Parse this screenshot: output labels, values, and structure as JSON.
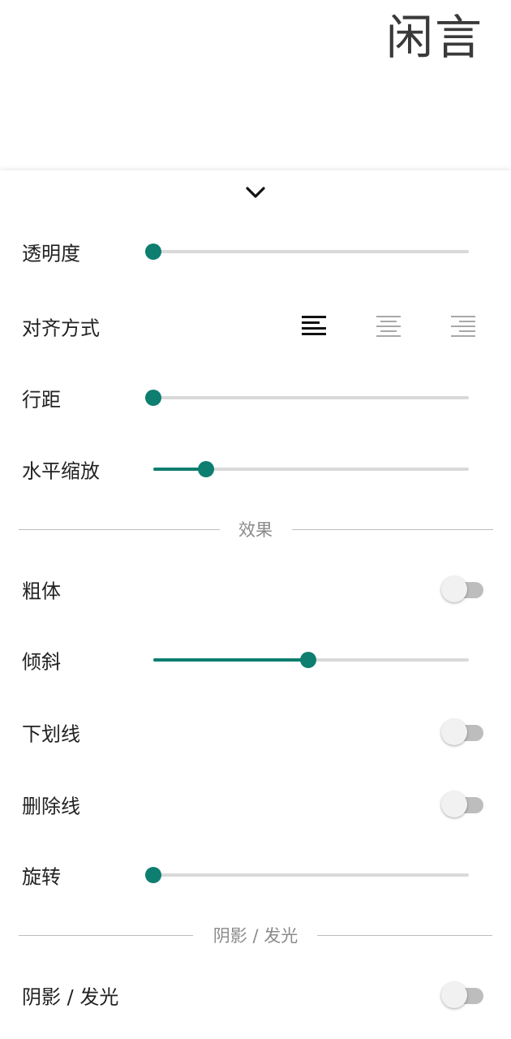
{
  "preview": {
    "text": "闲言"
  },
  "panel": {
    "collapse_icon": "chevron-down-icon",
    "accent_color": "#0d7e6f",
    "opacity": {
      "label": "透明度",
      "value": 0.0
    },
    "alignment": {
      "label": "对齐方式",
      "options": [
        "align-left-icon",
        "align-center-icon",
        "align-right-icon"
      ],
      "selected": "left"
    },
    "line_spacing": {
      "label": "行距",
      "value": 0.0
    },
    "horizontal_scale": {
      "label": "水平缩放",
      "value": 0.166
    },
    "effects_section": {
      "label": "效果"
    },
    "bold": {
      "label": "粗体",
      "on": false
    },
    "italic": {
      "label": "倾斜",
      "value": 0.49
    },
    "underline": {
      "label": "下划线",
      "on": false
    },
    "strikethrough": {
      "label": "删除线",
      "on": false
    },
    "rotation": {
      "label": "旋转",
      "value": 0.0
    },
    "shadow_section": {
      "label": "阴影 / 发光"
    },
    "shadow_glow": {
      "label": "阴影 / 发光",
      "on": false
    }
  }
}
